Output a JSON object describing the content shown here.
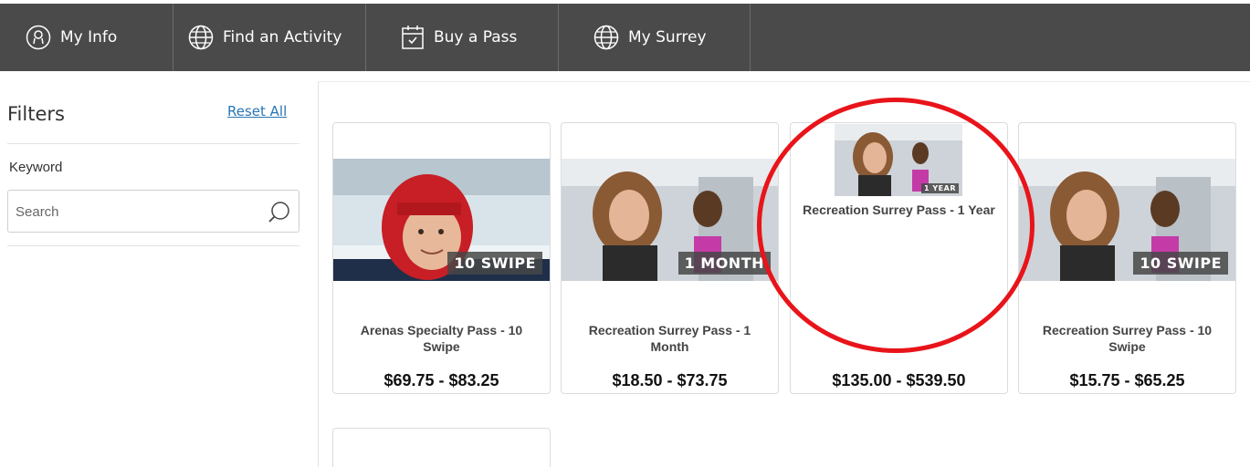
{
  "nav": {
    "items": [
      {
        "label": "My Info",
        "icon": "user-icon"
      },
      {
        "label": "Find an Activity",
        "icon": "globe-icon"
      },
      {
        "label": "Buy a Pass",
        "icon": "calendar-check-icon"
      },
      {
        "label": "My Surrey",
        "icon": "globe-icon"
      }
    ]
  },
  "filters": {
    "title": "Filters",
    "reset_label": "Reset All",
    "keyword_label": "Keyword",
    "search_placeholder": "Search"
  },
  "passes": [
    {
      "name": "Arenas Specialty Pass - 10 Swipe",
      "price": "$69.75 - $83.25",
      "badge": "10 SWIPE",
      "image": "hockey-player-photo"
    },
    {
      "name": "Recreation Surrey Pass - 1 Month",
      "price": "$18.50 - $73.75",
      "badge": "1 MONTH",
      "image": "spin-class-photo"
    },
    {
      "name": "Recreation Surrey Pass - 1 Year",
      "price": "$135.00 - $539.50",
      "badge": "1 YEAR",
      "image": "spin-class-photo"
    },
    {
      "name": "Recreation Surrey Pass - 10 Swipe",
      "price": "$15.75 - $65.25",
      "badge": "10 SWIPE",
      "image": "spin-class-photo"
    }
  ],
  "colors": {
    "nav_bg": "#4a4a4a",
    "link": "#2a76b6",
    "highlight_circle": "#e8141a"
  }
}
